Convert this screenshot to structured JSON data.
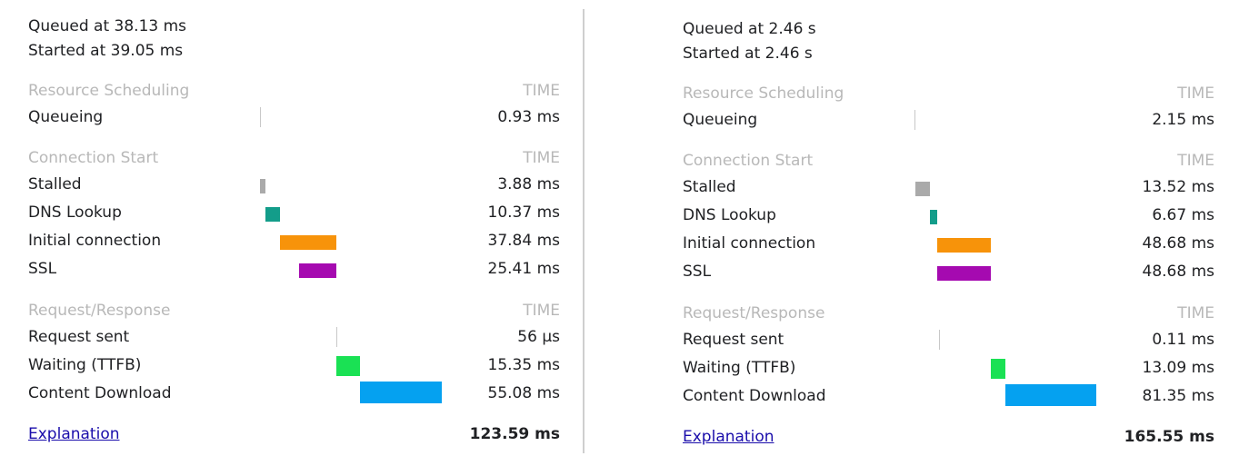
{
  "colors": {
    "stalled": "#aaaaaa",
    "dns": "#139d8a",
    "connection": "#f7930a",
    "ssl": "#a50ab0",
    "ttfb": "#1ae154",
    "download": "#05a1f0",
    "link": "#1a0dab"
  },
  "left": {
    "queued": "Queued at 38.13 ms",
    "started": "Started at 39.05 ms",
    "sections": {
      "scheduling": {
        "label": "Resource Scheduling",
        "time_label": "TIME"
      },
      "connection": {
        "label": "Connection Start",
        "time_label": "TIME"
      },
      "request": {
        "label": "Request/Response",
        "time_label": "TIME"
      }
    },
    "rows": {
      "queueing": {
        "label": "Queueing",
        "value": "0.93 ms"
      },
      "stalled": {
        "label": "Stalled",
        "value": "3.88 ms"
      },
      "dns": {
        "label": "DNS Lookup",
        "value": "10.37 ms"
      },
      "initial_connection": {
        "label": "Initial connection",
        "value": "37.84 ms"
      },
      "ssl": {
        "label": "SSL",
        "value": "25.41 ms"
      },
      "request_sent": {
        "label": "Request sent",
        "value": "56 μs"
      },
      "waiting": {
        "label": "Waiting (TTFB)",
        "value": "15.35 ms"
      },
      "content_download": {
        "label": "Content Download",
        "value": "55.08 ms"
      }
    },
    "explanation": "Explanation",
    "total": "123.59 ms"
  },
  "right": {
    "queued": "Queued at 2.46 s",
    "started": "Started at 2.46 s",
    "sections": {
      "scheduling": {
        "label": "Resource Scheduling",
        "time_label": "TIME"
      },
      "connection": {
        "label": "Connection Start",
        "time_label": "TIME"
      },
      "request": {
        "label": "Request/Response",
        "time_label": "TIME"
      }
    },
    "rows": {
      "queueing": {
        "label": "Queueing",
        "value": "2.15 ms"
      },
      "stalled": {
        "label": "Stalled",
        "value": "13.52 ms"
      },
      "dns": {
        "label": "DNS Lookup",
        "value": "6.67 ms"
      },
      "initial_connection": {
        "label": "Initial connection",
        "value": "48.68 ms"
      },
      "ssl": {
        "label": "SSL",
        "value": "48.68 ms"
      },
      "request_sent": {
        "label": "Request sent",
        "value": "0.11 ms"
      },
      "waiting": {
        "label": "Waiting (TTFB)",
        "value": "13.09 ms"
      },
      "content_download": {
        "label": "Content Download",
        "value": "81.35 ms"
      }
    },
    "explanation": "Explanation",
    "total": "165.55 ms"
  }
}
